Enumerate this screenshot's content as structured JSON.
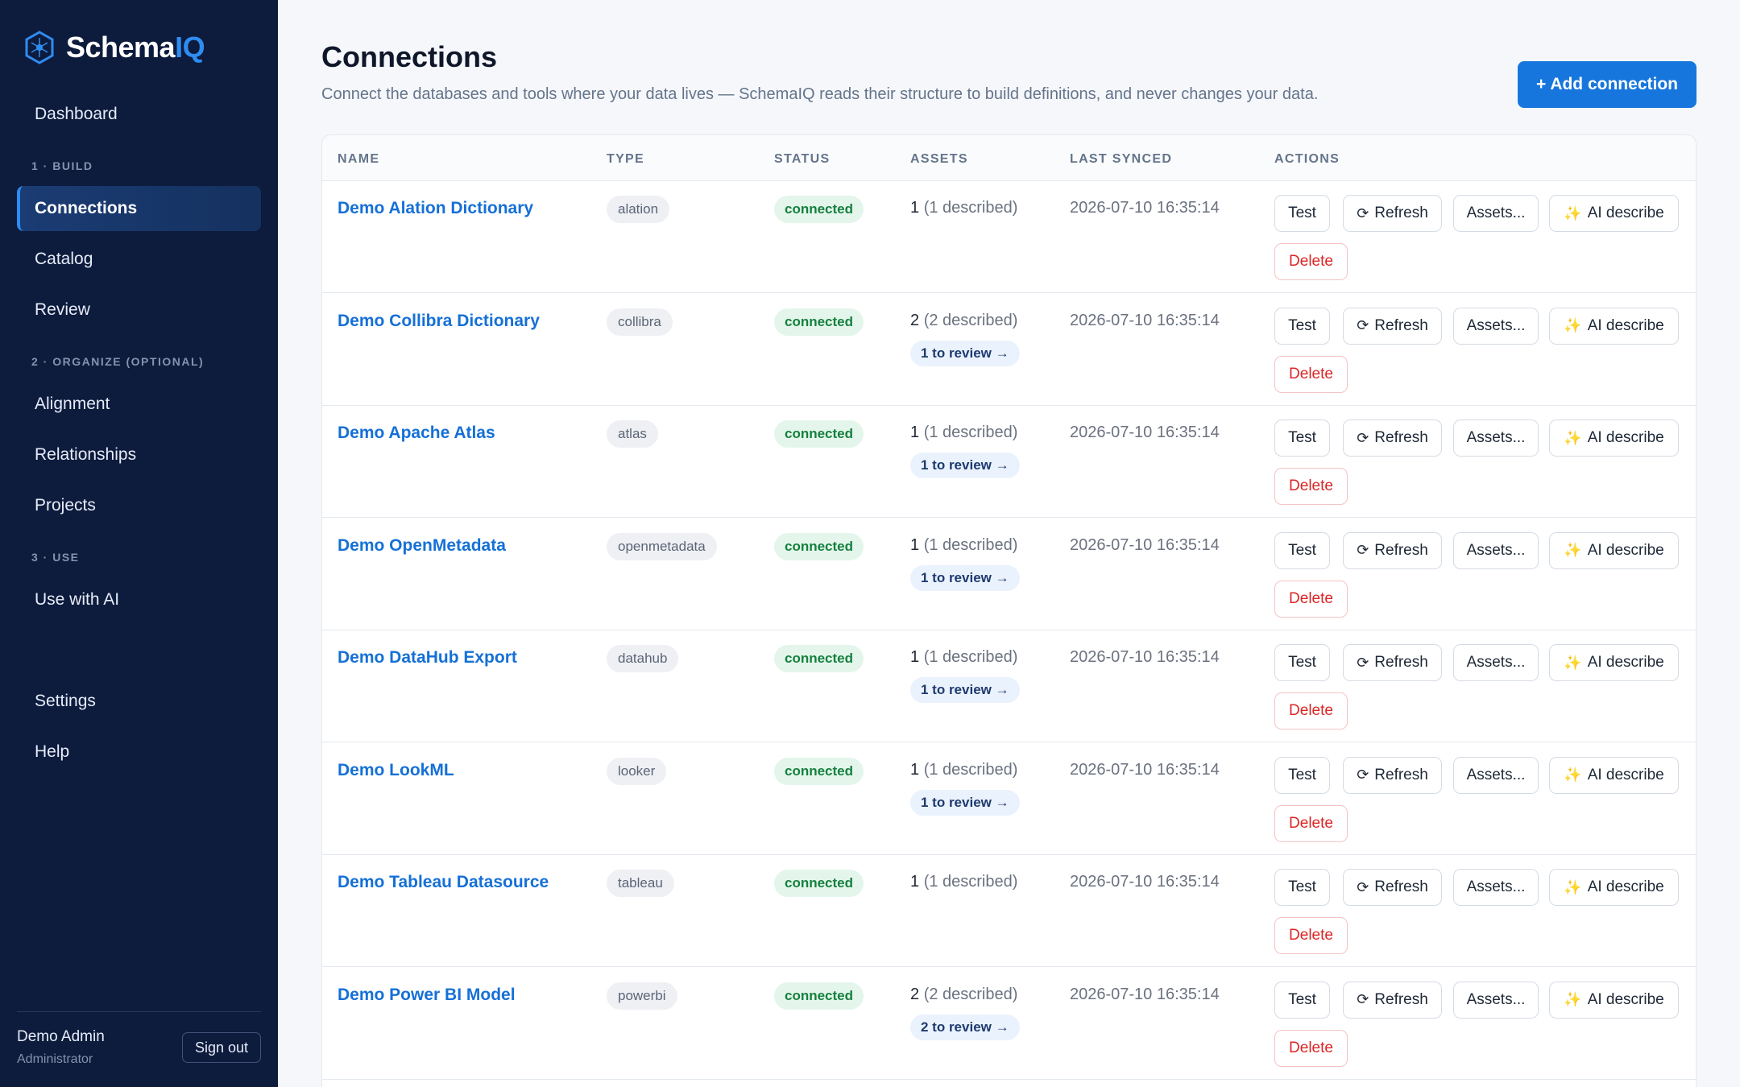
{
  "brand": {
    "prefix": "Schema",
    "accent": "IQ"
  },
  "sidebar": {
    "dashboard": "Dashboard",
    "section_build": "1 · BUILD",
    "connections": "Connections",
    "catalog": "Catalog",
    "review": "Review",
    "section_organize": "2 · ORGANIZE (OPTIONAL)",
    "alignment": "Alignment",
    "relationships": "Relationships",
    "projects": "Projects",
    "section_use": "3 · USE",
    "use_with_ai": "Use with AI",
    "settings": "Settings",
    "help": "Help",
    "user_name": "Demo Admin",
    "user_role": "Administrator",
    "sign_out": "Sign out"
  },
  "header": {
    "title": "Connections",
    "subtitle": "Connect the databases and tools where your data lives — SchemaIQ reads their structure to build definitions, and never changes your data.",
    "add_button": "+ Add connection"
  },
  "table": {
    "columns": [
      "NAME",
      "TYPE",
      "STATUS",
      "ASSETS",
      "LAST SYNCED",
      "ACTIONS"
    ],
    "actions": {
      "test": "Test",
      "refresh": "Refresh",
      "assets": "Assets...",
      "ai_describe": "AI describe",
      "delete": "Delete"
    },
    "rows": [
      {
        "name": "Demo Alation Dictionary",
        "type": "alation",
        "status": "connected",
        "count": "1",
        "described": "(1 described)",
        "review": "",
        "synced": "2026-07-10 16:35:14"
      },
      {
        "name": "Demo Collibra Dictionary",
        "type": "collibra",
        "status": "connected",
        "count": "2",
        "described": "(2 described)",
        "review": "1 to review →",
        "synced": "2026-07-10 16:35:14"
      },
      {
        "name": "Demo Apache Atlas",
        "type": "atlas",
        "status": "connected",
        "count": "1",
        "described": "(1 described)",
        "review": "1 to review →",
        "synced": "2026-07-10 16:35:14"
      },
      {
        "name": "Demo OpenMetadata",
        "type": "openmetadata",
        "status": "connected",
        "count": "1",
        "described": "(1 described)",
        "review": "1 to review →",
        "synced": "2026-07-10 16:35:14"
      },
      {
        "name": "Demo DataHub Export",
        "type": "datahub",
        "status": "connected",
        "count": "1",
        "described": "(1 described)",
        "review": "1 to review →",
        "synced": "2026-07-10 16:35:14"
      },
      {
        "name": "Demo LookML",
        "type": "looker",
        "status": "connected",
        "count": "1",
        "described": "(1 described)",
        "review": "1 to review →",
        "synced": "2026-07-10 16:35:14"
      },
      {
        "name": "Demo Tableau Datasource",
        "type": "tableau",
        "status": "connected",
        "count": "1",
        "described": "(1 described)",
        "review": "",
        "synced": "2026-07-10 16:35:14"
      },
      {
        "name": "Demo Power BI Model",
        "type": "powerbi",
        "status": "connected",
        "count": "2",
        "described": "(2 described)",
        "review": "2 to review →",
        "synced": "2026-07-10 16:35:14"
      }
    ]
  },
  "colors": {
    "sidebar_bg": "#0d1b3d",
    "accent": "#1776dd",
    "link": "#1570d6",
    "connected": "#15803d",
    "danger": "#dc2626"
  },
  "icons": {
    "logo": "hexagon-logo-icon",
    "refresh": "refresh-icon",
    "ai": "sparkles-icon"
  }
}
